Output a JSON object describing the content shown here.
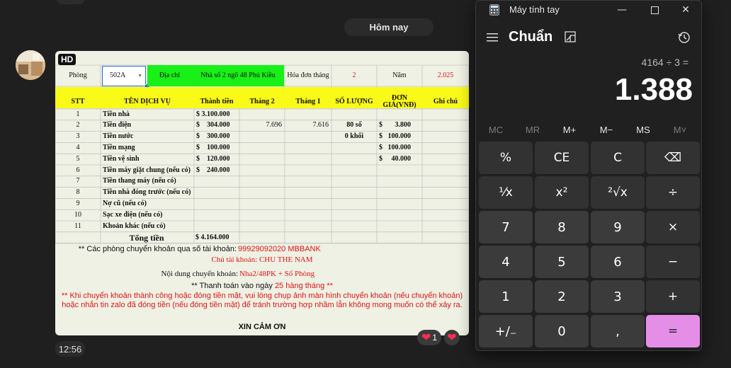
{
  "chat": {
    "date_separator": "Hôm nay",
    "message_time": "12:56",
    "hd_badge": "HD",
    "reactions": [
      {
        "emoji": "❤",
        "count": "1"
      },
      {
        "emoji": "❤",
        "count": ""
      }
    ]
  },
  "invoice": {
    "room_label": "Phòng",
    "room_value": "502A",
    "address_label": "Địa chỉ",
    "address_value": "Nhà số 2 ngõ 48 Phú Kiều",
    "invoice_month_label": "Hóa đơn tháng",
    "invoice_month_value": "2",
    "year_label": "Năm",
    "year_value": "2.025",
    "headers": [
      "STT",
      "TÊN DỊCH VỤ",
      "Thành tiền",
      "Tháng 2",
      "Tháng 1",
      "SỐ LƯỢNG",
      "ĐƠN GIÁ(VNĐ)",
      "Ghi chú"
    ],
    "rows": [
      {
        "stt": "1",
        "name": "Tiền nhà",
        "amount": "$ 3.100.000",
        "m2": "",
        "m1": "",
        "qty": "",
        "price": ""
      },
      {
        "stt": "2",
        "name": "Tiền điện",
        "amount": "$    304.000",
        "m2": "7.696",
        "m1": "7.616",
        "qty": "80 số",
        "price": "$       3.800"
      },
      {
        "stt": "3",
        "name": "Tiền nước",
        "amount": "$    300.000",
        "m2": "",
        "m1": "",
        "qty": "0 khối",
        "price": "$   100.000"
      },
      {
        "stt": "4",
        "name": "Tiền mạng",
        "amount": "$    100.000",
        "m2": "",
        "m1": "",
        "qty": "",
        "price": "$   100.000"
      },
      {
        "stt": "5",
        "name": "Tiền vệ sinh",
        "amount": "$    120.000",
        "m2": "",
        "m1": "",
        "qty": "",
        "price": "$     40.000"
      },
      {
        "stt": "6",
        "name": "Tiền máy giặt chung (nếu có)",
        "amount": "$    240.000",
        "m2": "",
        "m1": "",
        "qty": "",
        "price": ""
      },
      {
        "stt": "7",
        "name": "Tiền thang máy (nếu có)",
        "amount": "",
        "m2": "",
        "m1": "",
        "qty": "",
        "price": ""
      },
      {
        "stt": "8",
        "name": "Tiền nhà đóng trước (nếu có)",
        "amount": "",
        "m2": "",
        "m1": "",
        "qty": "",
        "price": ""
      },
      {
        "stt": "9",
        "name": "Nợ cũ (nếu có)",
        "amount": "",
        "m2": "",
        "m1": "",
        "qty": "",
        "price": ""
      },
      {
        "stt": "10",
        "name": "Sạc xe điện (nếu có)",
        "amount": "",
        "m2": "",
        "m1": "",
        "qty": "",
        "price": ""
      },
      {
        "stt": "11",
        "name": "Khoản khác (nếu có)",
        "amount": "",
        "m2": "",
        "m1": "",
        "qty": "",
        "price": ""
      }
    ],
    "total_label": "Tổng tiền",
    "total_value": "$ 4.164.000",
    "bank_label": "** Các phòng chuyển khoản qua số tài khoản:",
    "bank_value": "99929092020   MBBANK",
    "account_holder": "Chủ tài khoản: CHU THE NAM",
    "content_label": "Nội dung chuyển khoản:",
    "content_value": "Nha2/48PK + Số Phòng",
    "pay_day_prefix": "** Thanh toán vào ngày",
    "pay_day_value": "25 hàng tháng **",
    "note": "** Khi chuyển khoản thành công hoặc đóng tiền mặt, vui lòng chụp ảnh màn hình chuyển khoản (nếu chuyển khoản) hoặc nhắn tin zalo đã đóng tiền (nếu đóng tiền mặt) để tránh trường hợp nhầm lẫn không mong muốn có thể xảy ra.",
    "thanks": "XIN CẢM ƠN"
  },
  "calculator": {
    "window_title": "Máy tính tay",
    "mode": "Chuẩn",
    "expression": "4164 ÷ 3 =",
    "result": "1.388",
    "memory": [
      "MC",
      "MR",
      "M+",
      "M−",
      "MS",
      "M˅"
    ],
    "keys": [
      [
        "%",
        "CE",
        "C",
        "⌫"
      ],
      [
        "¹⁄x",
        "x²",
        "²√x",
        "÷"
      ],
      [
        "7",
        "8",
        "9",
        "×"
      ],
      [
        "4",
        "5",
        "6",
        "−"
      ],
      [
        "1",
        "2",
        "3",
        "+"
      ],
      [
        "+/₋",
        "0",
        ",",
        "="
      ]
    ],
    "colors": {
      "equals": "#e58ee8",
      "background": "#202020"
    }
  }
}
